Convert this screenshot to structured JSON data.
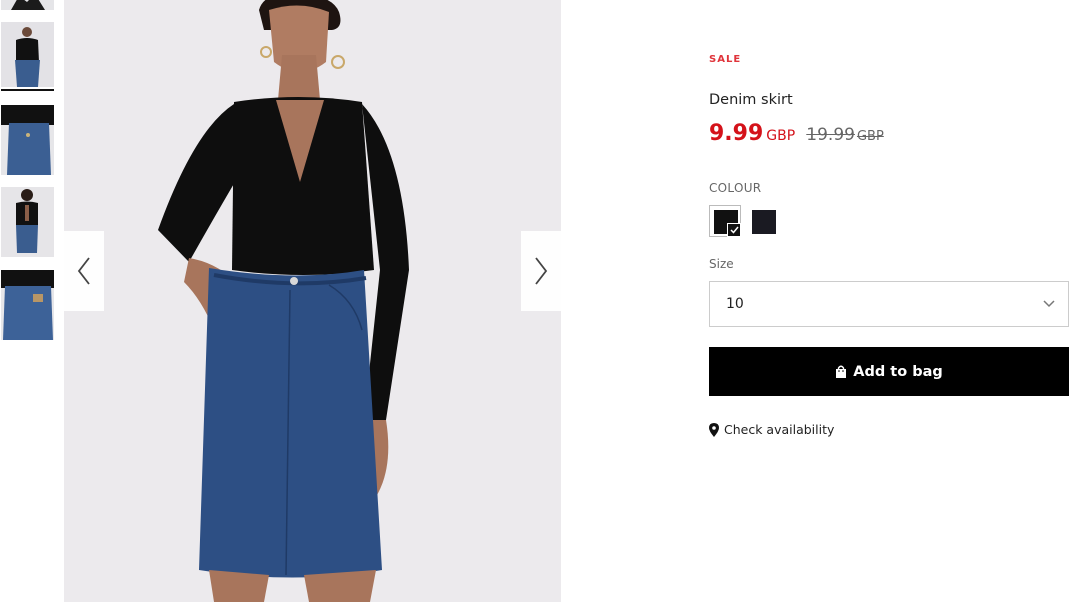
{
  "thumbnails": [
    {
      "name": "thumbnail-1",
      "alt_icon": "product-thumbnail",
      "active": false
    },
    {
      "name": "thumbnail-2",
      "alt_icon": "product-thumbnail",
      "active": true
    },
    {
      "name": "thumbnail-3",
      "alt_icon": "product-thumbnail",
      "active": false
    },
    {
      "name": "thumbnail-4",
      "alt_icon": "product-thumbnail",
      "active": false
    },
    {
      "name": "thumbnail-5",
      "alt_icon": "product-thumbnail",
      "active": false
    }
  ],
  "gallery": {
    "prev_icon": "chevron-left-icon",
    "next_icon": "chevron-right-icon"
  },
  "product": {
    "badge": "SALE",
    "title": "Denim skirt",
    "price_current": "9.99",
    "price_current_currency": "GBP",
    "price_old": "19.99",
    "price_old_currency": "GBP",
    "colour_label": "COLOUR",
    "colours": [
      "black",
      "dark-navy"
    ],
    "size_label": "Size",
    "size_value": "10",
    "add_to_bag_label": "Add to bag",
    "check_availability_label": "Check availability"
  },
  "colors": {
    "sale_red": "#e0343b",
    "price_red": "#d4121a",
    "button_bg": "#000000"
  }
}
